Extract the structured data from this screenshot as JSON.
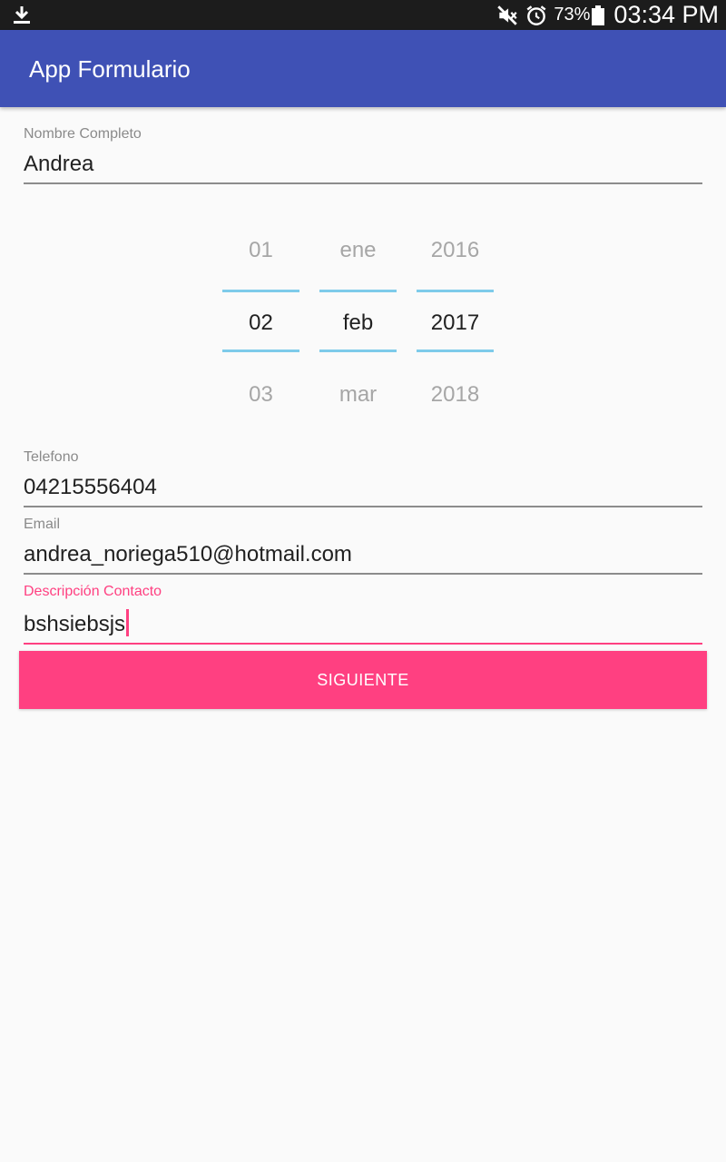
{
  "status_bar": {
    "battery_percent": "73%",
    "time": "03:34 PM",
    "icons": [
      "download-icon",
      "mute-icon",
      "alarm-icon",
      "battery-icon"
    ]
  },
  "app_bar": {
    "title": "App Formulario"
  },
  "form": {
    "name_field": {
      "label": "Nombre Completo",
      "value": "Andrea"
    },
    "date_picker": {
      "day": {
        "prev": "01",
        "current": "02",
        "next": "03"
      },
      "month": {
        "prev": "ene",
        "current": "feb",
        "next": "mar"
      },
      "year": {
        "prev": "2016",
        "current": "2017",
        "next": "2018"
      }
    },
    "phone_field": {
      "label": "Telefono",
      "value": "04215556404"
    },
    "email_field": {
      "label": "Email",
      "value": "andrea_noriega510@hotmail.com"
    },
    "description_field": {
      "label": "Descripción Contacto",
      "value": "bshsiebsjs"
    },
    "next_button": {
      "label": "SIGUIENTE"
    }
  },
  "colors": {
    "primary": "#3f51b5",
    "accent": "#ff4081",
    "picker_divider": "#7ecbea",
    "status_bar": "#1c1c1c"
  }
}
